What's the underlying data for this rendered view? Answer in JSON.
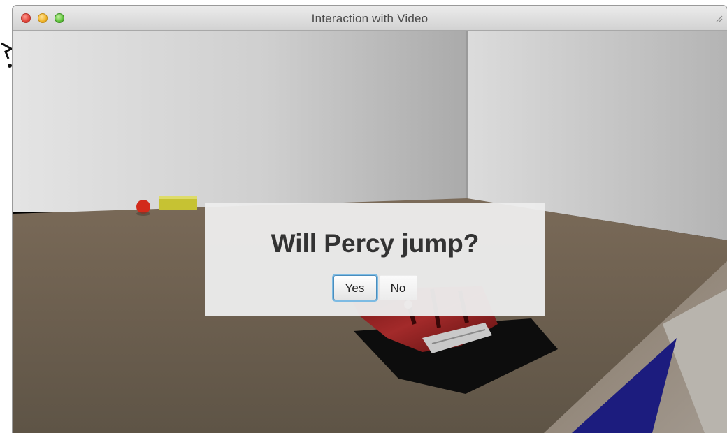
{
  "window": {
    "title": "Interaction with Video",
    "controls": {
      "close": "close-button",
      "minimize": "minimize-button",
      "zoom": "zoom-button"
    },
    "resize_icon": "resize-icon"
  },
  "dialog": {
    "question": "Will Percy jump?",
    "buttons": {
      "yes": "Yes",
      "no": "No"
    },
    "focused": "yes"
  },
  "colors": {
    "dialog_bg": "#ececec",
    "focus_ring": "#7dbbe3",
    "floor": "#6e6254",
    "wall": "#c8c8c8",
    "car_body": "#8a1f1f",
    "blue_ramp": "#1a1a7a"
  }
}
